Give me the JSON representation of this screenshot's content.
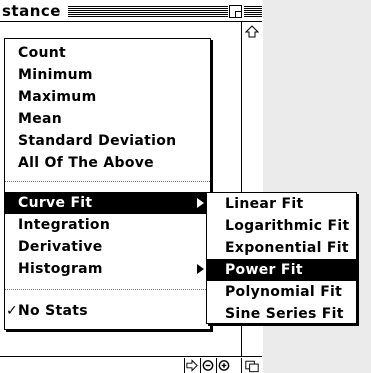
{
  "window": {
    "title": "stance"
  },
  "menu": {
    "items": [
      {
        "label": "Count"
      },
      {
        "label": "Minimum"
      },
      {
        "label": "Maximum"
      },
      {
        "label": "Mean"
      },
      {
        "label": "Standard Deviation"
      },
      {
        "label": "All Of The Above"
      },
      {
        "label": "Curve Fit",
        "submenu": true,
        "highlighted": true
      },
      {
        "label": "Integration"
      },
      {
        "label": "Derivative"
      },
      {
        "label": "Histogram",
        "submenu": true
      },
      {
        "label": "No Stats",
        "checked": true
      }
    ],
    "check_mark": "✓"
  },
  "submenu": {
    "items": [
      {
        "label": "Linear Fit"
      },
      {
        "label": "Logarithmic Fit"
      },
      {
        "label": "Exponential Fit"
      },
      {
        "label": "Power Fit",
        "highlighted": true
      },
      {
        "label": "Polynomial Fit"
      },
      {
        "label": "Sine Series Fit"
      }
    ]
  },
  "icons": {
    "scroll_up": "scroll-up-arrow-icon",
    "scroll_right": "scroll-right-arrow-icon",
    "zoom_out": "zoom-out-icon",
    "zoom_in": "zoom-in-icon",
    "grow_box": "grow-box-icon"
  },
  "colors": {
    "highlight": "#000000",
    "highlight_text": "#ffffff",
    "desktop": "#ebebeb"
  }
}
